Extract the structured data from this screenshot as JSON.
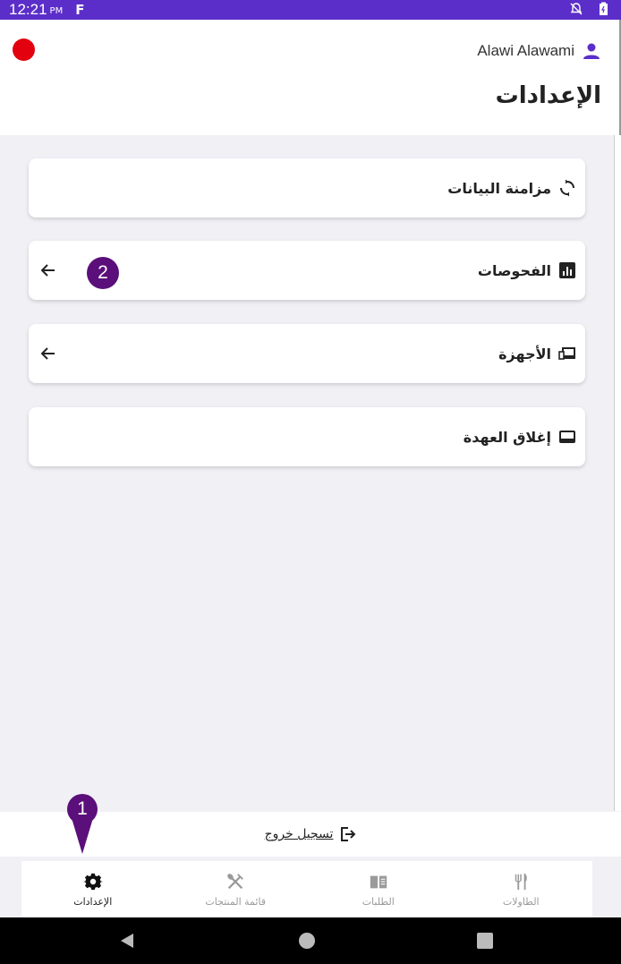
{
  "status_bar": {
    "time": "12:21",
    "ampm": "PM",
    "app_glyph": "F"
  },
  "header": {
    "user_name": "Alawi Alawami",
    "title": "الإعدادات",
    "record_color": "#e3000f"
  },
  "menu": [
    {
      "label": "مزامنة البيانات",
      "icon": "sync-icon",
      "has_arrow": false
    },
    {
      "label": "الفحوصات",
      "icon": "chart-icon",
      "has_arrow": true
    },
    {
      "label": "الأجهزة",
      "icon": "devices-icon",
      "has_arrow": true
    },
    {
      "label": "إغلاق العهدة",
      "icon": "close-custody-icon",
      "has_arrow": false
    }
  ],
  "logout": {
    "label": "تسجيل خروج"
  },
  "bottom_nav": [
    {
      "label": "الإعدادات",
      "icon": "gear-icon",
      "active": true
    },
    {
      "label": "قائمة المنتجات",
      "icon": "utensils-cross-icon",
      "active": false
    },
    {
      "label": "الطلبات",
      "icon": "book-icon",
      "active": false
    },
    {
      "label": "الطاولات",
      "icon": "fork-knife-icon",
      "active": false
    }
  ],
  "annotations": {
    "badge_1": "1",
    "badge_2": "2"
  },
  "colors": {
    "accent": "#5b2ec9",
    "badge": "#5b0f7a"
  }
}
